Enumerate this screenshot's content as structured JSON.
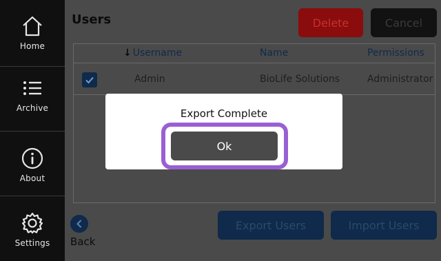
{
  "sidebar": {
    "items": [
      {
        "label": "Home",
        "icon": "home-icon"
      },
      {
        "label": "Archive",
        "icon": "list-icon"
      },
      {
        "label": "About",
        "icon": "info-icon"
      },
      {
        "label": "Settings",
        "icon": "gear-icon"
      }
    ]
  },
  "header": {
    "title": "Users",
    "delete_label": "Delete",
    "cancel_label": "Cancel"
  },
  "table": {
    "columns": [
      "Username",
      "Name",
      "Permissions"
    ],
    "sort_column": "Username",
    "rows": [
      {
        "checked": true,
        "username": "Admin",
        "name": "BioLife Solutions",
        "permissions": "Administrator"
      }
    ]
  },
  "footer": {
    "back_label": "Back",
    "export_label": "Export Users",
    "import_label": "Import Users"
  },
  "dialog": {
    "title": "Export Complete",
    "ok_label": "Ok"
  },
  "colors": {
    "sidebar_bg": "#101010",
    "main_bg": "#4a4a4a",
    "accent_navy": "#0f2a4a",
    "delete_red": "#8a0c0c",
    "highlight_purple": "#9a5fd4"
  }
}
